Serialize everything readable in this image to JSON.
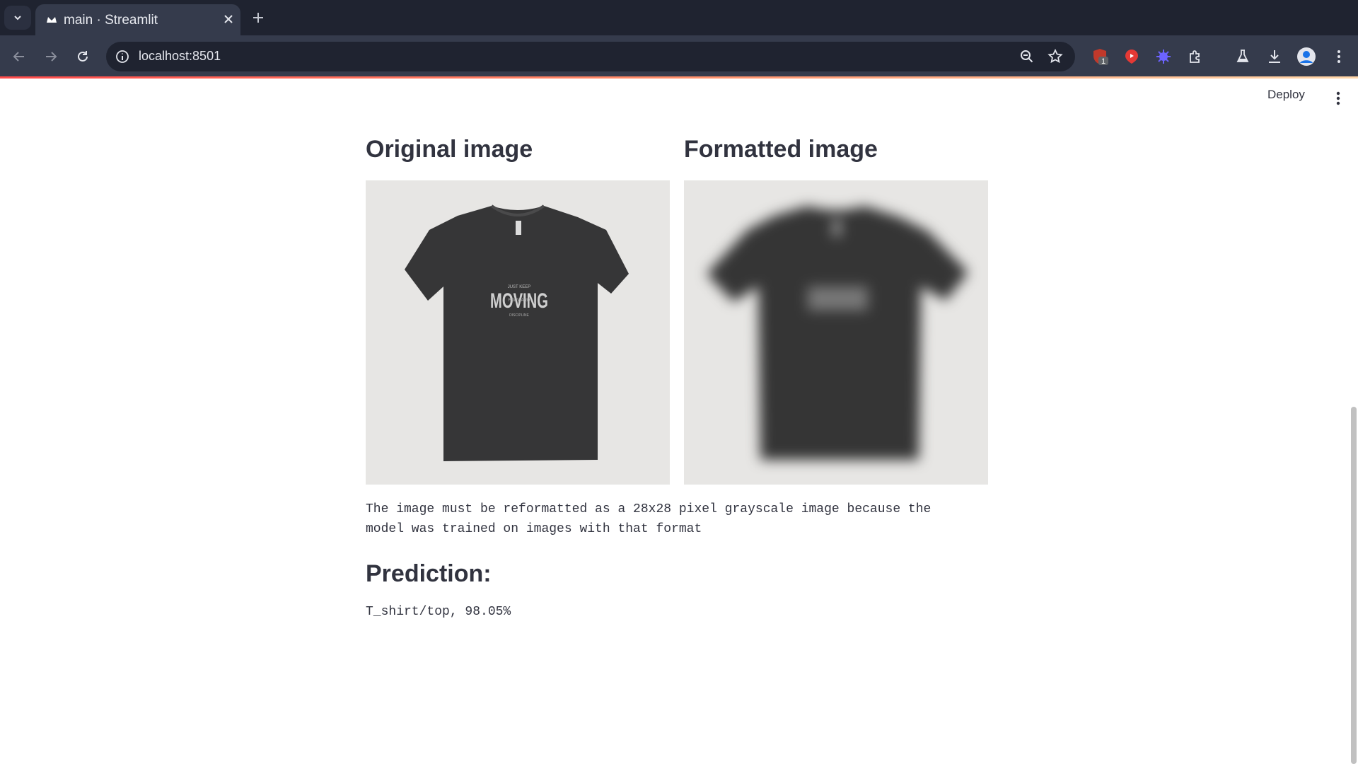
{
  "browser": {
    "tab_title": "main · Streamlit",
    "url": "localhost:8501",
    "extension_badge": "1"
  },
  "app": {
    "deploy_label": "Deploy",
    "original_heading": "Original image",
    "formatted_heading": "Formatted image",
    "caption": "The image must be reformatted as a 28x28 pixel grayscale image because the model was trained on images with that format",
    "prediction_heading": "Prediction:",
    "prediction_text": "T_shirt/top, 98.05%"
  },
  "shirt_print": {
    "line1": "JUST KEEP",
    "line2": "MOVING",
    "line3": "FORWARD",
    "line4": "DISCIPLINE"
  },
  "colors": {
    "chrome_dark": "#1f2330",
    "chrome_toolbar": "#353b4c",
    "text": "#31333f",
    "accent": "#ff4b4b"
  }
}
